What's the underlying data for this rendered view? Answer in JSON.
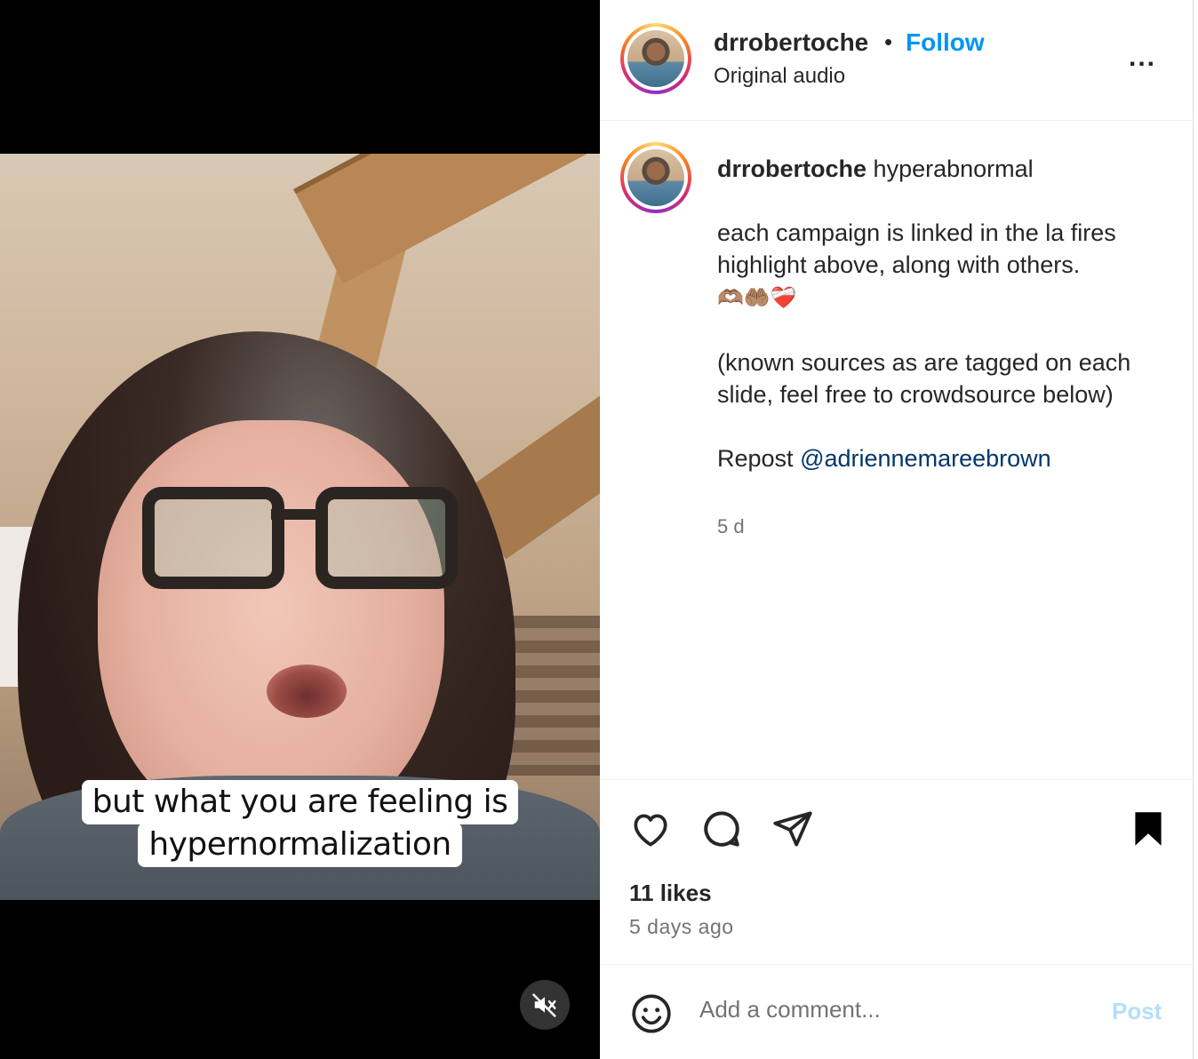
{
  "video": {
    "caption_line1": "but what you are feeling is",
    "caption_line2": "hypernormalization",
    "mute_icon": "speaker-muted-icon"
  },
  "header": {
    "username": "drrobertoche",
    "separator": "•",
    "follow_label": "Follow",
    "audio_label": "Original audio",
    "more_icon": "more-horizontal-icon",
    "more_label": "..."
  },
  "post": {
    "username": "drrobertoche",
    "first_line": "hyperabnormal",
    "paragraph1": "each campaign is linked in the la fires highlight above, along with others.",
    "emojis": "🫶🏽🤲🏽❤️‍🩹",
    "paragraph2": "(known sources as are tagged on each slide, feel free to crowdsource below)",
    "repost_prefix": "Repost",
    "mention": "@adriennemareebrown",
    "relative_time": "5 d"
  },
  "actions": {
    "like_icon": "heart-icon",
    "comment_icon": "comment-bubble-icon",
    "share_icon": "paper-plane-icon",
    "save_icon": "bookmark-filled-icon",
    "likes": "11 likes",
    "posted": "5 days ago"
  },
  "comment_box": {
    "emoji_icon": "smiley-icon",
    "placeholder": "Add a comment...",
    "post_label": "Post"
  },
  "colors": {
    "follow": "#0095f6",
    "mention": "#00376b",
    "post_disabled": "#b2dffc",
    "muted_text": "#737373"
  }
}
